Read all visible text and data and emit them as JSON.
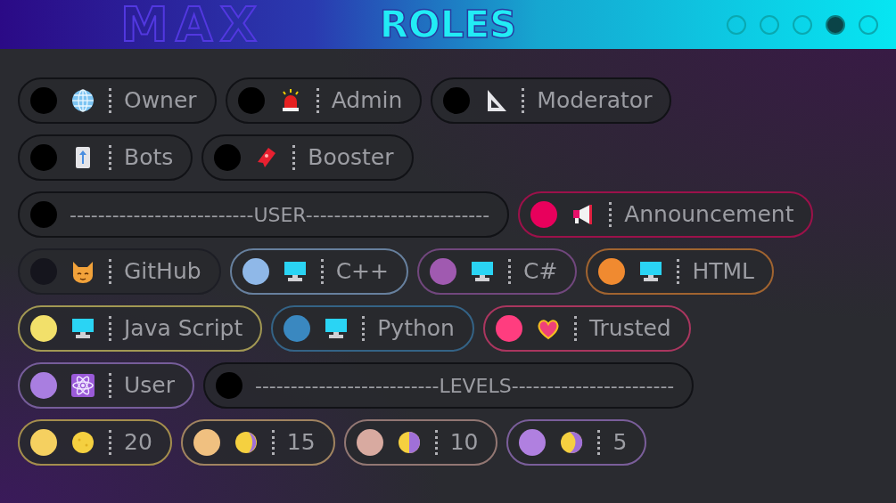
{
  "header": {
    "background_text": "MAX",
    "title": "ROLES",
    "pager": [
      {
        "selected": false
      },
      {
        "selected": false
      },
      {
        "selected": false
      },
      {
        "selected": true
      },
      {
        "selected": false
      }
    ]
  },
  "rows": [
    [
      {
        "kind": "globe",
        "color": "#000000",
        "name": "Owner"
      },
      {
        "kind": "siren",
        "color": "#000000",
        "name": "Admin"
      },
      {
        "kind": "ruler",
        "color": "#000000",
        "name": "Moderator"
      }
    ],
    [
      {
        "kind": "elevator",
        "color": "#000000",
        "name": "Bots"
      },
      {
        "kind": "ticket",
        "color": "#000000",
        "name": "Booster"
      }
    ],
    [
      {
        "kind": "divider",
        "color": "#000000",
        "name": "--------------------------USER--------------------------"
      },
      {
        "kind": "megaphone",
        "color": "#e8005c",
        "name": "Announcement"
      }
    ],
    [
      {
        "kind": "cat",
        "color": "#15151d",
        "name": "GitHub"
      },
      {
        "kind": "monitor",
        "color": "#8fb8e8",
        "name": "C++"
      },
      {
        "kind": "monitor",
        "color": "#a05ab0",
        "name": "C#"
      },
      {
        "kind": "monitor",
        "color": "#f08a30",
        "name": "HTML"
      }
    ],
    [
      {
        "kind": "monitor",
        "color": "#f2e06a",
        "name": "Java Script"
      },
      {
        "kind": "monitor",
        "color": "#3a88c0",
        "name": "Python"
      },
      {
        "kind": "heart",
        "color": "#ff3d7f",
        "name": "Trusted"
      }
    ],
    [
      {
        "kind": "atom",
        "color": "#a97ee0",
        "name": "User"
      },
      {
        "kind": "divider",
        "color": "#000000",
        "name": "--------------------------LEVELS-----------------------"
      }
    ],
    [
      {
        "kind": "moon-full",
        "color": "#f5d060",
        "name": "20"
      },
      {
        "kind": "moon-gibbous",
        "color": "#f0c080",
        "name": "15"
      },
      {
        "kind": "moon-half",
        "color": "#d8aaa0",
        "name": "10"
      },
      {
        "kind": "moon-crescent",
        "color": "#b080e0",
        "name": "5"
      }
    ]
  ]
}
